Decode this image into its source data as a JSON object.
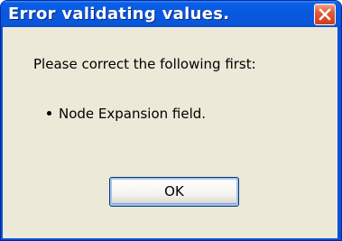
{
  "window": {
    "title": "Error validating values."
  },
  "dialog": {
    "message": "Please correct the following first:",
    "items": [
      "Node Expansion field."
    ],
    "ok_label": "OK"
  },
  "icons": {
    "close": "close-icon"
  },
  "colors": {
    "titlebar": "#0a5fe6",
    "close_button": "#e05a36",
    "client_background": "#ece9d8",
    "button_border": "#003c74"
  }
}
